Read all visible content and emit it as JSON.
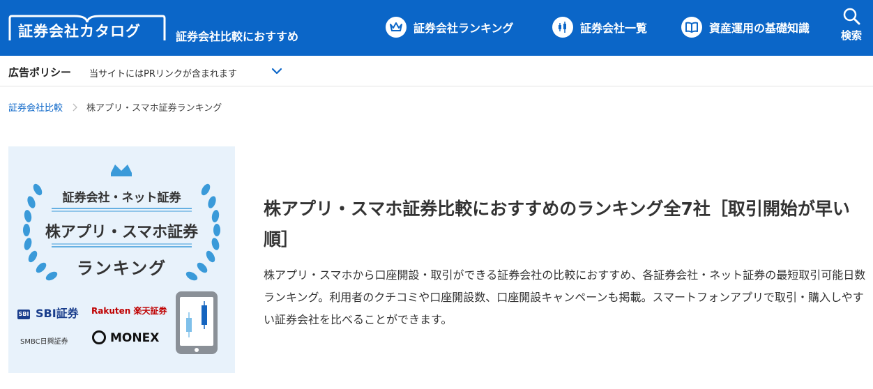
{
  "header": {
    "logo_text": "証券会社カタログ",
    "tagline": "証券会社比較におすすめ",
    "nav": [
      {
        "label": "証券会社ランキング",
        "icon": "crown-icon"
      },
      {
        "label": "証券会社一覧",
        "icon": "candlestick-icon"
      },
      {
        "label": "資産運用の基礎知識",
        "icon": "book-icon"
      }
    ],
    "search_label": "検索",
    "brand_color": "#0b66c8"
  },
  "adbar": {
    "title": "広告ポリシー",
    "note": "当サイトにはPRリンクが含まれます"
  },
  "breadcrumb": {
    "items": [
      "証券会社比較",
      "株アプリ・スマホ証券ランキング"
    ]
  },
  "hero": {
    "line1": "証券会社・ネット証券",
    "line2": "株アプリ・スマホ証券",
    "line3": "ランキング",
    "logos": {
      "sbi": "SBI証券",
      "sbi_mark": "SBI",
      "rakuten": "Rakuten 楽天証券",
      "smbc": "SMBC日興証券",
      "monex": "MONEX"
    }
  },
  "main": {
    "title": "株アプリ・スマホ証券比較におすすめのランキング全7社［取引開始が早い順］",
    "description": "株アプリ・スマホから口座開設・取引ができる証券会社の比較におすすめ、各証券会社・ネット証券の最短取引可能日数ランキング。利用者のクチコミや口座開設数、口座開設キャンペーンも掲載。スマートフォンアプリで取引・購入しやすい証券会社を比べることができます。"
  }
}
